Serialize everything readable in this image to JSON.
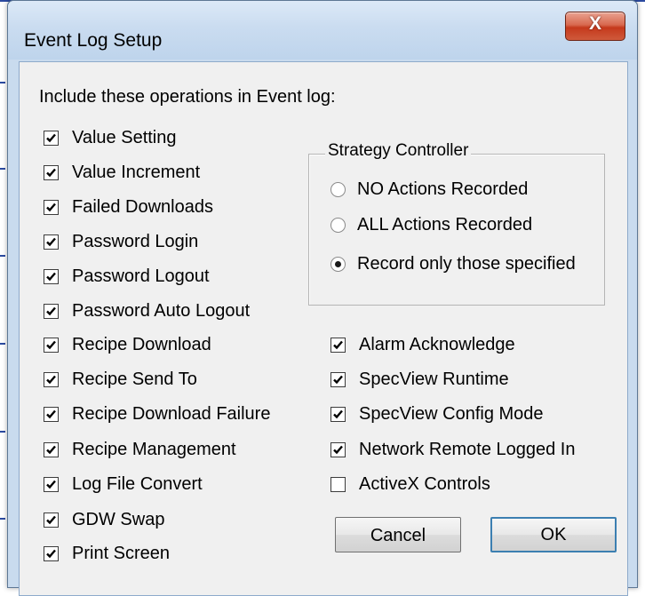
{
  "window": {
    "title": "Event Log Setup",
    "close_glyph": "X"
  },
  "instruction": "Include these operations in Event log:",
  "left_checks": [
    {
      "label": "Value Setting",
      "checked": true
    },
    {
      "label": "Value Increment",
      "checked": true
    },
    {
      "label": "Failed Downloads",
      "checked": true
    },
    {
      "label": "Password Login",
      "checked": true
    },
    {
      "label": "Password Logout",
      "checked": true
    },
    {
      "label": "Password Auto Logout",
      "checked": true
    },
    {
      "label": "Recipe Download",
      "checked": true
    },
    {
      "label": "Recipe Send To",
      "checked": true
    },
    {
      "label": "Recipe Download Failure",
      "checked": true
    },
    {
      "label": "Recipe Management",
      "checked": true
    },
    {
      "label": "Log File Convert",
      "checked": true
    },
    {
      "label": "GDW Swap",
      "checked": true
    },
    {
      "label": "Print Screen",
      "checked": true
    }
  ],
  "strategy_controller": {
    "title": "Strategy Controller",
    "options": [
      {
        "label": "NO Actions Recorded",
        "selected": false
      },
      {
        "label": "ALL Actions Recorded",
        "selected": false
      },
      {
        "label": "Record only those specified",
        "selected": true
      }
    ]
  },
  "right_checks": [
    {
      "label": "Alarm Acknowledge",
      "checked": true
    },
    {
      "label": "SpecView Runtime",
      "checked": true
    },
    {
      "label": "SpecView Config Mode",
      "checked": true
    },
    {
      "label": "Network Remote Logged In",
      "checked": true
    },
    {
      "label": "ActiveX Controls",
      "checked": false
    }
  ],
  "buttons": {
    "cancel": "Cancel",
    "ok": "OK"
  }
}
